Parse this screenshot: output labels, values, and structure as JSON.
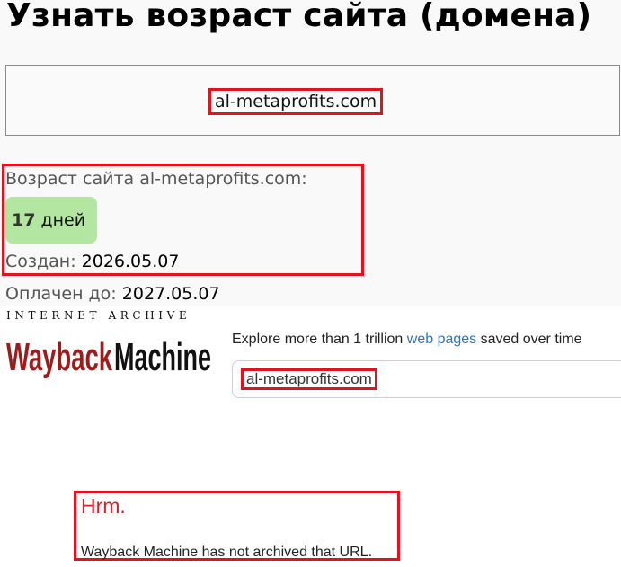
{
  "header": {
    "title": "Узнать возраст сайта (домена)"
  },
  "domain_input": {
    "value": "al-metaprofits.com"
  },
  "age_result": {
    "label": "Возраст сайта al-metaprofits.com:",
    "days_number": "17",
    "days_unit": "дней",
    "created_label": "Создан:",
    "created_value": "2026.05.07",
    "paid_label": "Оплачен до:",
    "paid_value": "2027.05.07"
  },
  "wayback": {
    "caption": "INTERNET ARCHIVE",
    "logo_word_a": "Wayback",
    "logo_word_b": "Machine",
    "explore_prefix": "Explore more than 1 trillion",
    "explore_link": "web pages",
    "explore_suffix": "saved over time",
    "search_value": "al-metaprofits.com",
    "notice_title": "Hrm.",
    "notice_message": "Wayback Machine has not archived that URL."
  },
  "colors": {
    "highlight_border": "#e0141e",
    "age_badge_bg": "#b3e6a0",
    "wayback_red": "#9e1b1b",
    "link_blue": "#3472b5"
  }
}
